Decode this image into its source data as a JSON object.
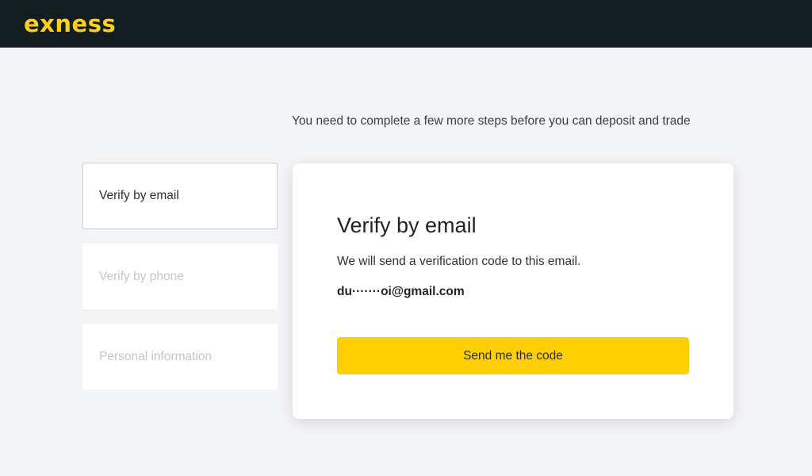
{
  "header": {
    "logo_text": "exness",
    "logo_color": "#fcd01d",
    "background": "#141d22"
  },
  "notice": "You need to complete a few more steps before you can deposit and trade",
  "steps": [
    {
      "label": "Verify by email",
      "active": true
    },
    {
      "label": "Verify by phone",
      "active": false
    },
    {
      "label": "Personal information",
      "active": false
    }
  ],
  "card": {
    "title": "Verify by email",
    "description": "We will send a verification code to this email.",
    "email": "du·······oi@gmail.com",
    "button_label": "Send me the code",
    "button_color": "#ffcf02"
  }
}
